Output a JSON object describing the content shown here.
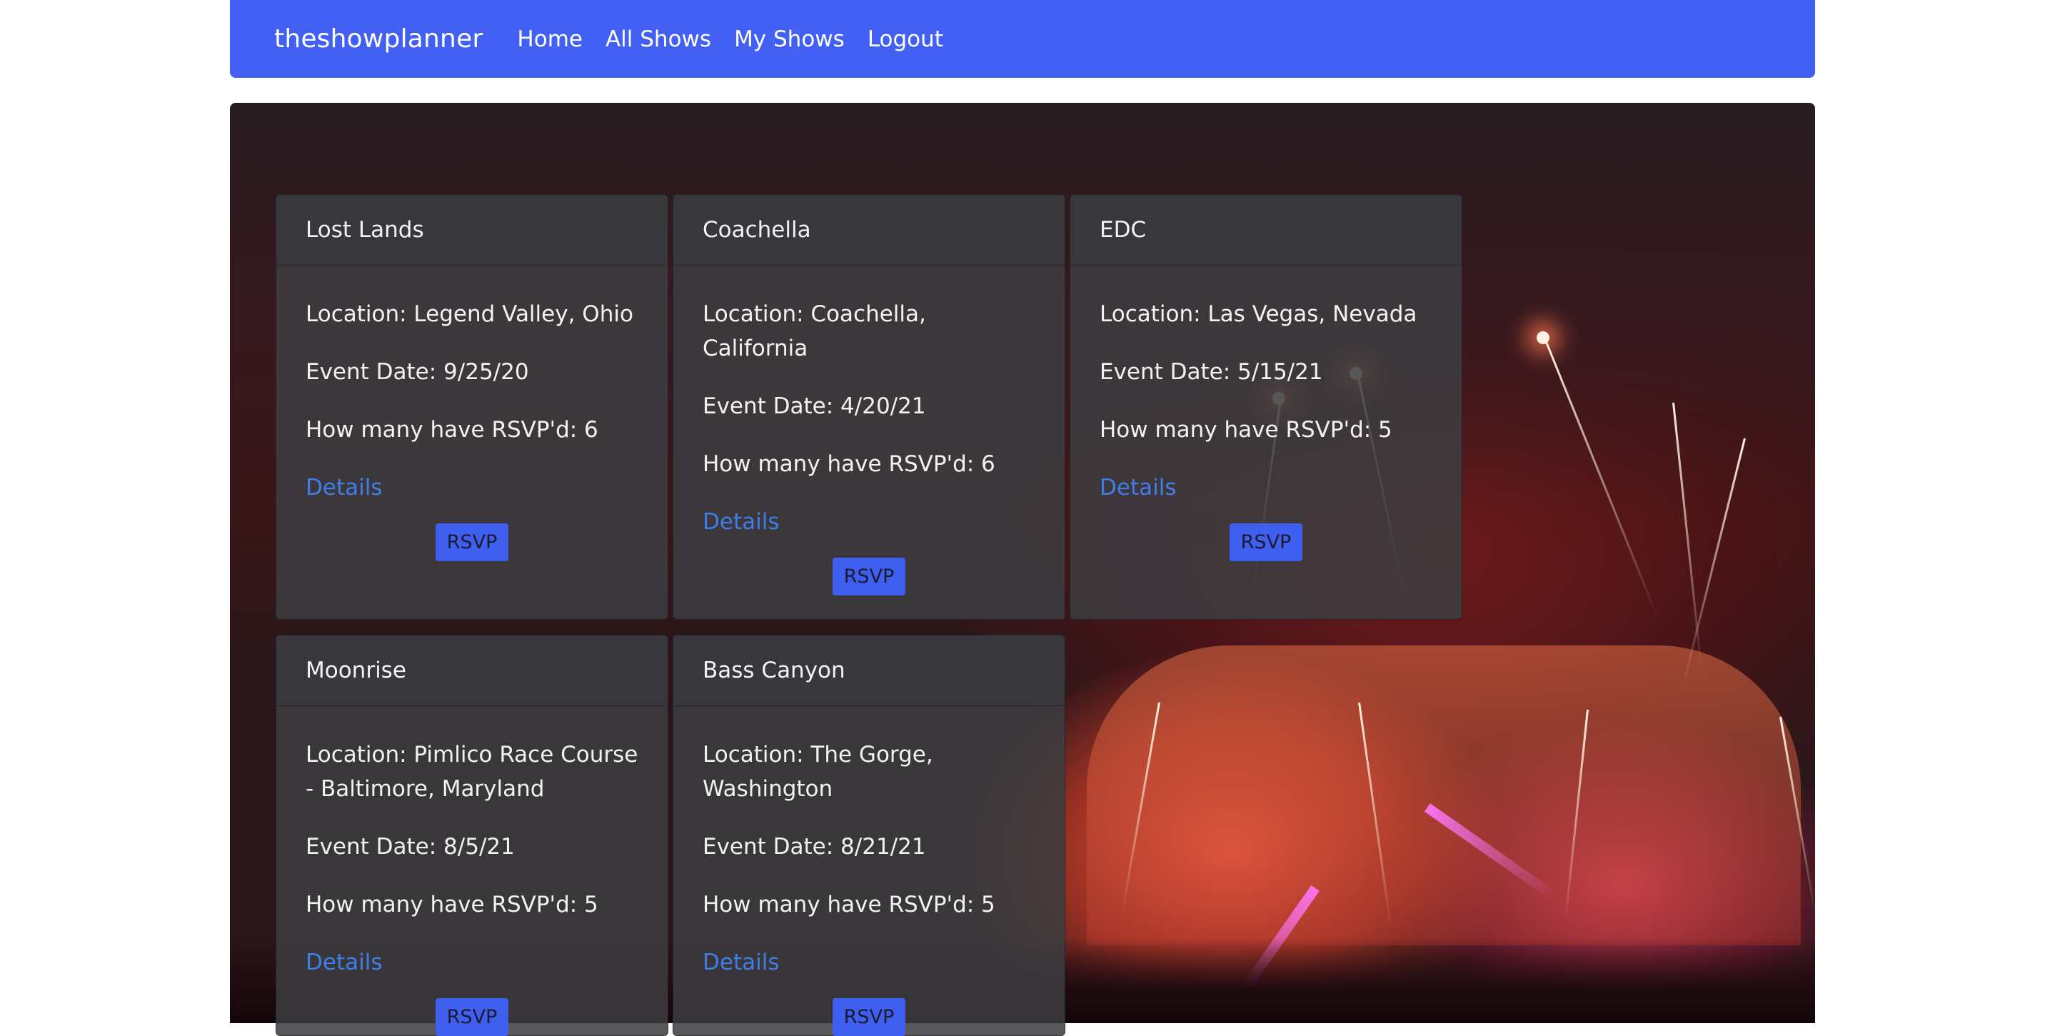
{
  "navbar": {
    "brand": "theshowplanner",
    "links": [
      "Home",
      "All Shows",
      "My Shows",
      "Logout"
    ]
  },
  "shows": [
    {
      "name": "Lost Lands",
      "location": "Location: Legend Valley, Ohio",
      "date": "Event Date: 9/25/20",
      "rsvp_count": "How many have RSVP'd: 6",
      "details_label": "Details",
      "rsvp_label": "RSVP"
    },
    {
      "name": "Coachella",
      "location": "Location: Coachella, California",
      "date": "Event Date: 4/20/21",
      "rsvp_count": "How many have RSVP'd: 6",
      "details_label": "Details",
      "rsvp_label": "RSVP"
    },
    {
      "name": "EDC",
      "location": "Location: Las Vegas, Nevada",
      "date": "Event Date: 5/15/21",
      "rsvp_count": "How many have RSVP'd: 5",
      "details_label": "Details",
      "rsvp_label": "RSVP"
    },
    {
      "name": "Moonrise",
      "location": "Location: Pimlico Race Course - Baltimore, Maryland",
      "date": "Event Date: 8/5/21",
      "rsvp_count": "How many have RSVP'd: 5",
      "details_label": "Details",
      "rsvp_label": "RSVP"
    },
    {
      "name": "Bass Canyon",
      "location": "Location: The Gorge, Washington",
      "date": "Event Date: 8/21/21",
      "rsvp_count": "How many have RSVP'd: 5",
      "details_label": "Details",
      "rsvp_label": "RSVP"
    }
  ],
  "colors": {
    "navbar": "#4260f3",
    "link": "#3f7ee8",
    "button": "#3e5ff0"
  }
}
